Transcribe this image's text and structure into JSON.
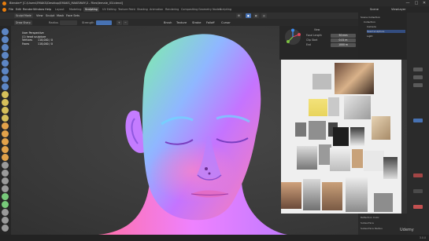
{
  "window": {
    "title": "Blender* [C:\\Users\\EMAKS\\Desktop\\EMAKS_MAKEWAY\\3 - Files\\female_03.blend]",
    "controls": [
      "—",
      "□",
      "✕"
    ]
  },
  "menu": {
    "items": [
      "File",
      "Edit",
      "Render",
      "Window",
      "Help"
    ],
    "tabs": [
      "Layout",
      "Modeling",
      "Sculpting",
      "UV Editing",
      "Texture Paint",
      "Shading",
      "Animation",
      "Rendering",
      "Compositing",
      "Geometry Nodes",
      "Scripting"
    ],
    "active_tab": "Sculpting",
    "scene_label": "Scene",
    "view_layer_label": "ViewLayer"
  },
  "header": {
    "mode": "Sculpt Mode",
    "menus": [
      "View",
      "Sculpt",
      "Mask",
      "Face Sets"
    ],
    "right_menus": [
      "Brush",
      "Texture",
      "Stroke",
      "Falloff",
      "Cursor"
    ]
  },
  "toolbar": {
    "brush": "Draw Sharp",
    "radius_label": "Radius",
    "strength_label": "Strength"
  },
  "stats": {
    "line1": "User Perspective",
    "line2": "(1) head sculpture",
    "vertices_label": "Vertices",
    "vertices_value": "118,000 / 0",
    "faces_label": "Faces",
    "faces_value": "118,000 / 0"
  },
  "npanel": {
    "header": "View",
    "rows": [
      {
        "label": "Focal Length",
        "value": "50 mm"
      },
      {
        "label": "Clip Start",
        "value": "0.01 m"
      },
      {
        "label": "End",
        "value": "1000 m"
      }
    ]
  },
  "outliner": {
    "items": [
      "Scene Collection",
      "Collection",
      "Camera",
      "head sculpture",
      "Light"
    ]
  },
  "props": {
    "rows": [
      "Reflection Color",
      "Subsurface",
      "Subsurface Radius"
    ]
  },
  "status": {
    "version": "3.0.0"
  },
  "watermark": "Udemy",
  "colors": {
    "accent": "#4772b3",
    "active_tab": "#3d3d3d",
    "ref_bg": "#efefef"
  }
}
